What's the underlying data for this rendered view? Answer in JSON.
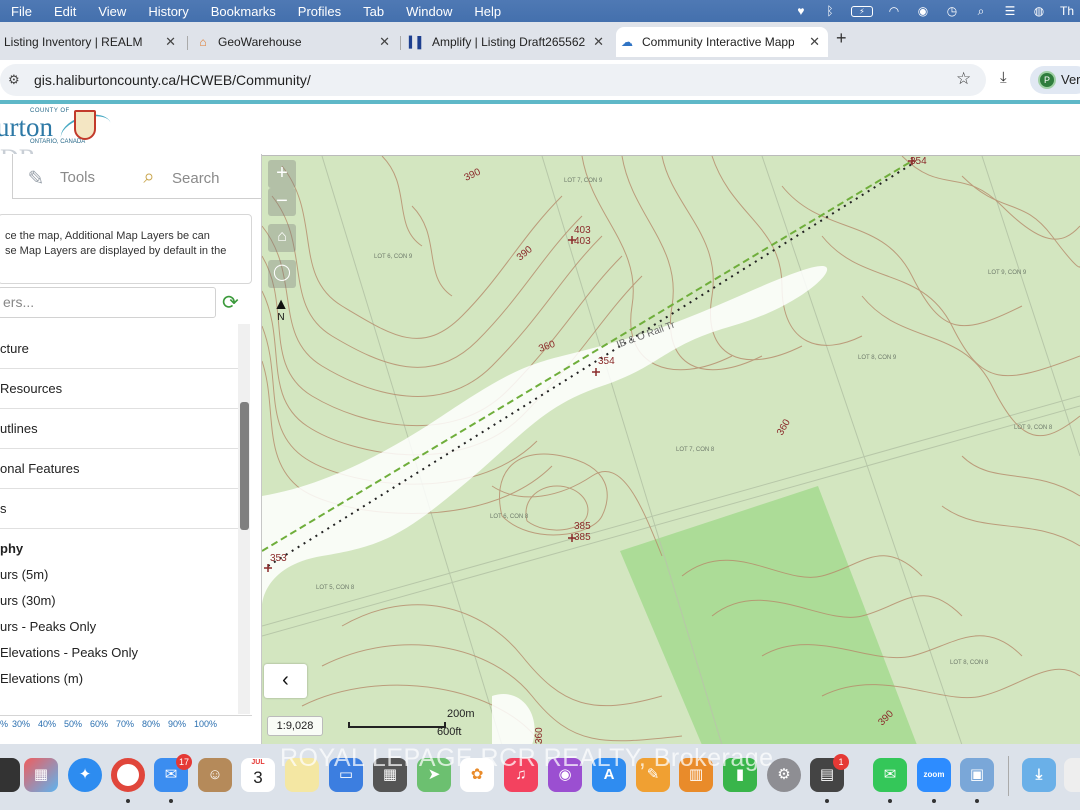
{
  "menubar": {
    "items": [
      "File",
      "Edit",
      "View",
      "History",
      "Bookmarks",
      "Profiles",
      "Tab",
      "Window",
      "Help"
    ],
    "user_initial": "Th"
  },
  "tabs": [
    {
      "title": "Listing Inventory | REALM",
      "icon": "realm-icon"
    },
    {
      "title": "GeoWarehouse",
      "icon": "house-icon"
    },
    {
      "title": "Amplify | Listing Draft265562",
      "icon": "amplify-icon"
    },
    {
      "title": "Community Interactive Mappi",
      "icon": "cloud-icon",
      "active": true
    }
  ],
  "address": {
    "url": "gis.haliburtoncounty.ca/HCWEB/Community/"
  },
  "profile": {
    "label": "Ver",
    "initial": "P"
  },
  "logo": {
    "county_text": "COUNTY OF",
    "name": "urton",
    "province": "ONTARIO, CANADA",
    "ghost": "DR"
  },
  "panel": {
    "tools_label": "Tools",
    "search_label": "Search",
    "description_line1": "ce the map, Additional Map Layers be can",
    "description_line2": "se Map Layers are displayed by default in the",
    "filter_placeholder": "ers...",
    "layers": [
      "cture",
      "Resources",
      "utlines",
      "onal Features",
      "s"
    ],
    "group_heading": "phy",
    "sublayers": [
      "urs (5m)",
      "urs (30m)",
      "urs - Peaks Only",
      "Elevations - Peaks Only",
      "Elevations (m)"
    ],
    "opacity": [
      "%",
      "30%",
      "40%",
      "50%",
      "60%",
      "70%",
      "80%",
      "90%",
      "100%"
    ]
  },
  "map": {
    "scale_ratio": "1:9,028",
    "scale_metric": "200m",
    "scale_imperial": "600ft",
    "elevation_labels": [
      "354",
      "390",
      "403",
      "403",
      "390",
      "360",
      "354",
      "360",
      "385",
      "385",
      "353",
      "390",
      "360"
    ],
    "lot_labels": [
      "LOT 7, CON 9",
      "LOT 6, CON 9",
      "LOT 9, CON 9",
      "LOT 8, CON 9",
      "LOT 7, CON 8",
      "LOT 6, CON 8",
      "LOT 5, CON 8",
      "LOT 9, CON 8",
      "LOT 8, CON 8"
    ],
    "rail_label": "IB & O Rail Tr",
    "zoom_in": "+",
    "zoom_out": "−",
    "north": "N",
    "collapse": "‹"
  },
  "dock": {
    "mail_badge": "17",
    "calendar_month": "JUL",
    "calendar_day": "3",
    "extra_badge": "1",
    "zoom_label": "zoom",
    "watermark": "ROYAL LEPAGE RCR REALTY, Brokerage"
  }
}
